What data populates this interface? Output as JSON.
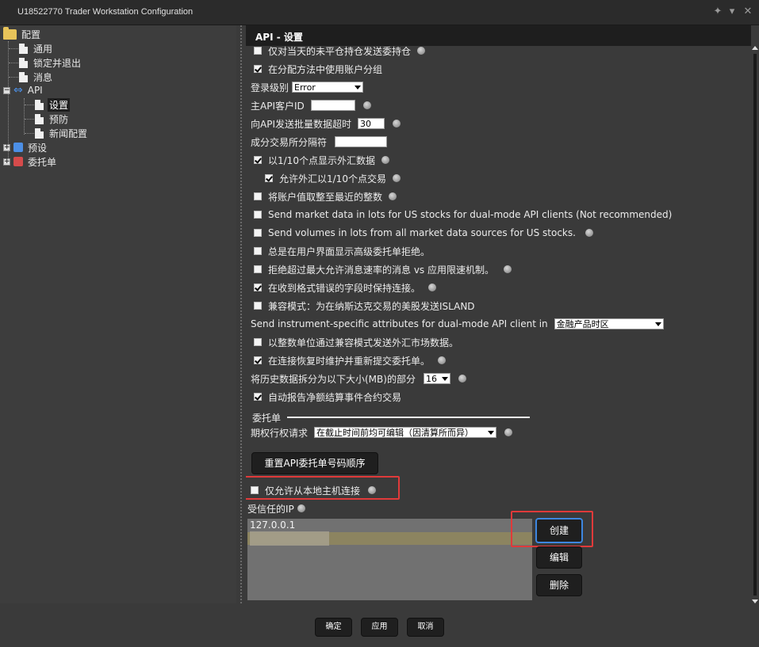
{
  "window": {
    "title": "U18522770 Trader Workstation Configuration"
  },
  "tree": {
    "root": "配置",
    "items": {
      "general": "通用",
      "lock_exit": "锁定并退出",
      "messages": "消息",
      "api": "API",
      "api_settings": "设置",
      "api_precautions": "预防",
      "api_news": "新闻配置",
      "presets": "预设",
      "orders": "委托单"
    }
  },
  "panel": {
    "header": "API - 设置",
    "rows": {
      "r0": "仅对当天的未平仓持仓发送委持仓",
      "r1": "在分配方法中使用账户分组",
      "log_level_label": "登录级别",
      "log_level_value": "Error",
      "master_client_label": "主API客户ID",
      "master_client_value": "",
      "timeout_label": "向API发送批量数据超时",
      "timeout_value": "30",
      "separator_label": "成分交易所分隔符",
      "separator_value": "",
      "fx_tenths": "以1/10个点显示外汇数据",
      "fx_tenths_trade": "允许外汇以1/10个点交易",
      "round_account": "将账户值取整至最近的整数",
      "market_lots": "Send market data in lots for US stocks for dual-mode API clients (Not recommended)",
      "volumes_lots": "Send volumes in lots from all market data sources for US stocks.",
      "show_advanced_reject": "总是在用户界面显示高级委托单拒绝。",
      "reject_rate": "拒绝超过最大允许消息速率的消息 vs 应用限速机制。",
      "keep_connection": "在收到格式错误的字段时保持连接。",
      "compat_island": "兼容模式：为在纳斯达克交易的美股发送ISLAND",
      "instrument_attr_label": "Send instrument-specific attributes for dual-mode API client in",
      "instrument_attr_value": "金融产品时区",
      "fx_compat": "以整数单位通过兼容模式发送外汇市场数据。",
      "maintain_resubmit": "在连接恢复时维护并重新提交委托单。",
      "hist_split_label": "将历史数据拆分为以下大小(MB)的部分",
      "hist_split_value": "16",
      "auto_report": "自动报告净额结算事件合约交易"
    },
    "orders_section": {
      "title": "委托单",
      "exercise_label": "期权行权请求",
      "exercise_value": "在截止时间前均可编辑（因清算所而异）",
      "reset_button": "重置API委托单号码顺序"
    },
    "localhost_only": "仅允许从本地主机连接",
    "trusted_ip_label": "受信任的IP",
    "trusted_ips": [
      "127.0.0.1",
      ""
    ],
    "buttons": {
      "create": "创建",
      "edit": "编辑",
      "delete": "删除"
    }
  },
  "footer": {
    "ok": "确定",
    "apply": "应用",
    "cancel": "取消"
  },
  "colors": {
    "header_bg": "#1e1e1e",
    "highlight": "#e03a3a",
    "focus": "#3d86e0"
  }
}
